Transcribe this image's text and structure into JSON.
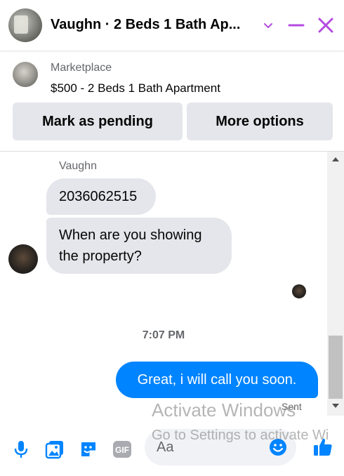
{
  "header": {
    "title": "Vaughn · 2 Beds 1 Bath Ap...",
    "icons": [
      "chevron-down-icon",
      "minimize-icon",
      "close-icon"
    ],
    "accent_color": "#b44be1"
  },
  "marketplace": {
    "label": "Marketplace",
    "listing": "$500 - 2 Beds 1 Bath Apartment",
    "buttons": {
      "pending": "Mark as pending",
      "more": "More options"
    }
  },
  "conversation": {
    "sender_name": "Vaughn",
    "incoming": [
      "2036062515",
      "When are you showing the property?"
    ],
    "timestamp": "7:07 PM",
    "outgoing": "Great, i will call you soon.",
    "status": "Sent",
    "outgoing_color": "#0084ff"
  },
  "composer": {
    "placeholder": "Aa",
    "icons": [
      "microphone-icon",
      "photo-icon",
      "sticker-icon",
      "gif-icon",
      "emoji-icon",
      "like-icon"
    ],
    "gif_label": "GIF",
    "icon_color": "#0084ff"
  },
  "watermark": {
    "line1": "Activate Windows",
    "line2": "Go to Settings to activate Wi"
  }
}
